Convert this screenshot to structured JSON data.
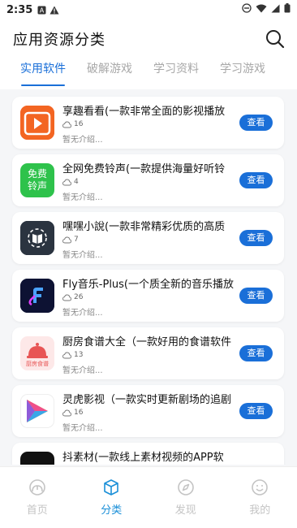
{
  "status_bar": {
    "time": "2:35"
  },
  "header": {
    "title": "应用资源分类"
  },
  "tabs": [
    {
      "label": "实用软件",
      "active": true
    },
    {
      "label": "破解游戏",
      "active": false
    },
    {
      "label": "学习资料",
      "active": false
    },
    {
      "label": "学习游戏",
      "active": false
    }
  ],
  "apps": [
    {
      "name": "享趣看看(一款非常全面的影视播放",
      "downloads": "16",
      "desc": "暂无介绍...",
      "button": "查看",
      "icon": "play-app-icon"
    },
    {
      "name": "全网免费铃声(一款提供海量好听铃",
      "downloads": "4",
      "desc": "暂无介绍...",
      "button": "查看",
      "icon": "ringtone-app-icon",
      "icon_text_line1": "免费",
      "icon_text_line2": "铃声"
    },
    {
      "name": "嘿嘿小說(一款非常精彩优质的高质",
      "downloads": "7",
      "desc": "暂无介绍...",
      "button": "查看",
      "icon": "book-app-icon"
    },
    {
      "name": "Fly音乐-Plus(一个质全新的音乐播放",
      "downloads": "26",
      "desc": "暂无介绍...",
      "button": "查看",
      "icon": "music-app-icon"
    },
    {
      "name": "厨房食谱大全（一款好用的食谱软件",
      "downloads": "13",
      "desc": "暂无介绍...",
      "button": "查看",
      "icon": "recipe-app-icon",
      "icon_text": "厨房食谱"
    },
    {
      "name": "灵虎影视（一款实时更新剧场的追剧",
      "downloads": "16",
      "desc": "暂无介绍...",
      "button": "查看",
      "icon": "video-app-icon"
    },
    {
      "name": "抖素材(一款线上素材视频的APP软",
      "downloads": "",
      "desc": "",
      "button": "",
      "icon": "material-app-icon"
    }
  ],
  "bottom_nav": [
    {
      "label": "首页",
      "icon": "home-icon",
      "active": false
    },
    {
      "label": "分类",
      "icon": "category-cube-icon",
      "active": true
    },
    {
      "label": "发现",
      "icon": "compass-icon",
      "active": false
    },
    {
      "label": "我的",
      "icon": "smiley-icon",
      "active": false
    }
  ],
  "colors": {
    "accent": "#1a6fd8",
    "nav_active": "#1a8fd8"
  }
}
